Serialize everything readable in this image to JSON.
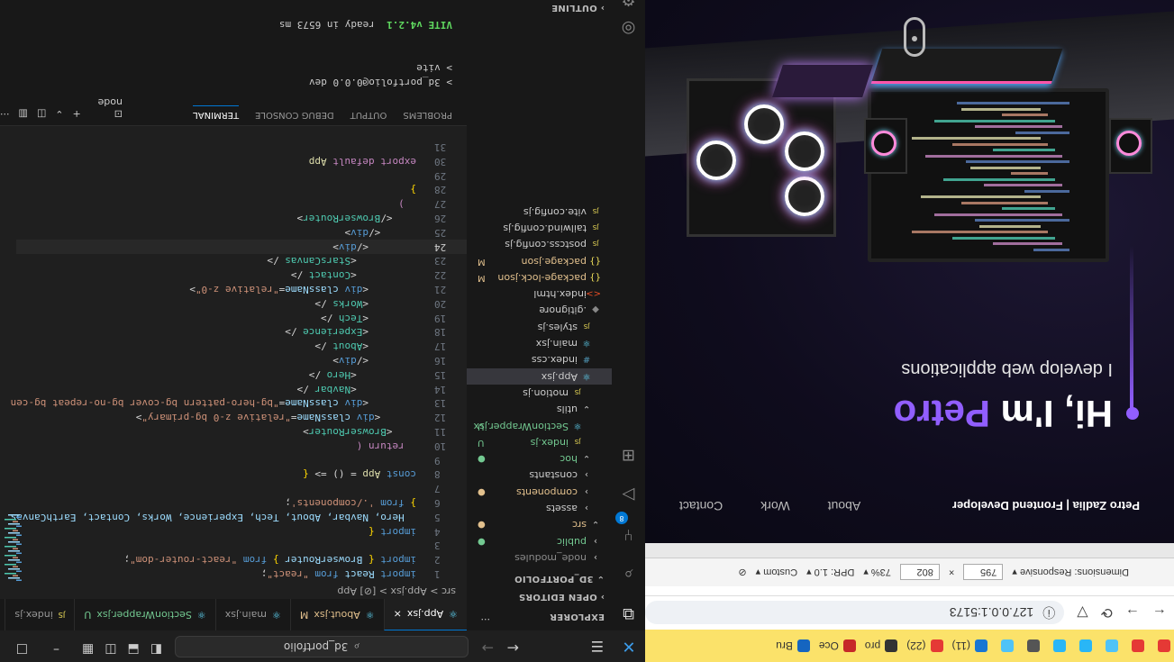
{
  "bookmarks": [
    {
      "label": "",
      "color": "#e53935"
    },
    {
      "label": "",
      "color": "#e53935"
    },
    {
      "label": "",
      "color": "#4fc3f7"
    },
    {
      "label": "",
      "color": "#29b6f6"
    },
    {
      "label": "",
      "color": "#29b6f6"
    },
    {
      "label": "",
      "color": "#555555"
    },
    {
      "label": "",
      "color": "#4fc3f7"
    },
    {
      "label": "(11)",
      "color": "#1976d2"
    },
    {
      "label": "(22)",
      "color": "#e53935"
    },
    {
      "label": "pro",
      "color": "#333333"
    },
    {
      "label": "Oce",
      "color": "#c62828"
    },
    {
      "label": "Bru",
      "color": "#1565c0"
    }
  ],
  "browser": {
    "url": "127.0.0.1:5173",
    "devtools": {
      "dimensions": "Dimensions: Responsive",
      "width": "795",
      "height": "802",
      "zoom": "73%",
      "dpr": "DPR: 1.0",
      "throttle": "Custom"
    }
  },
  "site": {
    "brand": "Petro Zadlia | Frontend Developer",
    "nav": [
      "About",
      "Work",
      "Contact"
    ],
    "hero_prefix": "Hi, I'm ",
    "hero_name": "Petro",
    "hero_sub": "I develop web applications"
  },
  "vscode": {
    "search_text": "3d_portfolio",
    "tabs": [
      {
        "label": "App.jsx",
        "icon": "react-icon",
        "active": true,
        "status": ""
      },
      {
        "label": "About.jsx",
        "icon": "react-icon",
        "active": false,
        "status": "M"
      },
      {
        "label": "main.jsx",
        "icon": "react-icon",
        "active": false,
        "status": ""
      },
      {
        "label": "SectionWrapper.jsx",
        "icon": "react-icon",
        "active": false,
        "status": "U"
      },
      {
        "label": "index.js",
        "icon": "js-icon",
        "active": false,
        "status": ""
      }
    ],
    "breadcrumb": "src > App.jsx > [⊘] App",
    "sidebar": {
      "explorer_title": "EXPLORER",
      "open_editors": "OPEN EDITORS",
      "project": "3D_PORTFOLIO",
      "outline": "OUTLINE",
      "tree": [
        {
          "label": "node_modules",
          "icon": "chevron-right",
          "depth": 0,
          "status": "",
          "color": "#8b8b8b"
        },
        {
          "label": "public",
          "icon": "chevron-right",
          "depth": 0,
          "status": "●",
          "color": "#73c991"
        },
        {
          "label": "src",
          "icon": "chevron-down",
          "depth": 0,
          "status": "●",
          "color": "#e2c08d"
        },
        {
          "label": "assets",
          "icon": "chevron-right",
          "depth": 1,
          "status": "",
          "color": "#cccccc"
        },
        {
          "label": "components",
          "icon": "chevron-right",
          "depth": 1,
          "status": "●",
          "color": "#e2c08d"
        },
        {
          "label": "constants",
          "icon": "chevron-right",
          "depth": 1,
          "status": "",
          "color": "#cccccc"
        },
        {
          "label": "hoc",
          "icon": "chevron-down",
          "depth": 1,
          "status": "●",
          "color": "#73c991"
        },
        {
          "label": "index.js",
          "icon": "JS",
          "depth": 2,
          "status": "U",
          "color": "#73c991"
        },
        {
          "label": "SectionWrapper.jsx",
          "icon": "⚛",
          "depth": 2,
          "status": "U",
          "color": "#73c991"
        },
        {
          "label": "utils",
          "icon": "chevron-down",
          "depth": 1,
          "status": "",
          "color": "#cccccc"
        },
        {
          "label": "motion.js",
          "icon": "JS",
          "depth": 2,
          "status": "",
          "color": "#cccccc"
        },
        {
          "label": "App.jsx",
          "icon": "⚛",
          "depth": 1,
          "status": "",
          "color": "#cccccc",
          "selected": true
        },
        {
          "label": "index.css",
          "icon": "#",
          "depth": 1,
          "status": "",
          "color": "#cccccc"
        },
        {
          "label": "main.jsx",
          "icon": "⚛",
          "depth": 1,
          "status": "",
          "color": "#cccccc"
        },
        {
          "label": "styles.js",
          "icon": "JS",
          "depth": 1,
          "status": "",
          "color": "#cccccc"
        },
        {
          "label": ".gitignore",
          "icon": "◆",
          "depth": 0,
          "status": "",
          "color": "#cccccc"
        },
        {
          "label": "index.html",
          "icon": "<>",
          "depth": 0,
          "status": "",
          "color": "#cccccc"
        },
        {
          "label": "package-lock.json",
          "icon": "{}",
          "depth": 0,
          "status": "M",
          "color": "#e2c08d"
        },
        {
          "label": "package.json",
          "icon": "{}",
          "depth": 0,
          "status": "M",
          "color": "#e2c08d"
        },
        {
          "label": "postcss.config.js",
          "icon": "JS",
          "depth": 0,
          "status": "",
          "color": "#cccccc"
        },
        {
          "label": "tailwind.config.js",
          "icon": "JS",
          "depth": 0,
          "status": "",
          "color": "#cccccc"
        },
        {
          "label": "vite.config.js",
          "icon": "JS",
          "depth": 0,
          "status": "",
          "color": "#cccccc"
        }
      ]
    },
    "code_lines": [
      {
        "n": "1",
        "html": "<span class='kw'>import</span> <span class='at'>React</span> <span class='kw'>from</span> <span class='sr'>\"react\"</span><span class='pl'>;</span>"
      },
      {
        "n": "2",
        "html": "<span class='kw'>import</span> <span class='br'>{</span> <span class='at'>BrowserRouter</span> <span class='br'>}</span> <span class='kw'>from</span> <span class='sr'>\"react-router-dom\"</span><span class='pl'>;</span>"
      },
      {
        "n": "3",
        "html": ""
      },
      {
        "n": "4",
        "html": "<span class='kw'>import</span> <span class='br'>{</span>"
      },
      {
        "n": "5",
        "html": "  <span class='at'>Hero, Navbar, About, Tech, Experience, Works, Contact, EarthCanvas</span>"
      },
      {
        "n": "6",
        "html": "<span class='br'>}</span> <span class='kw'>from</span> <span class='sr'>'./components'</span><span class='pl'>;</span>"
      },
      {
        "n": "7",
        "html": ""
      },
      {
        "n": "8",
        "html": "<span class='kw'>const</span> <span class='fn'>App</span> <span class='pl'>= () =&gt;</span> <span class='br'>{</span>"
      },
      {
        "n": "9",
        "html": ""
      },
      {
        "n": "10",
        "html": "  <span class='kc'>return</span> <span class='kc'>(</span>"
      },
      {
        "n": "11",
        "html": "    <span class='pl'>&lt;</span><span class='tg'>BrowserRouter</span><span class='pl'>&gt;</span>"
      },
      {
        "n": "12",
        "html": "      <span class='pl'>&lt;</span><span class='kw'>div</span> <span class='at'>className</span><span class='pl'>=</span><span class='sr'>\"relative z-0 bg-primary\"</span><span class='pl'>&gt;</span>"
      },
      {
        "n": "13",
        "html": "        <span class='pl'>&lt;</span><span class='kw'>div</span> <span class='at'>className</span><span class='pl'>=</span><span class='sr'>\"bg-hero-pattern bg-cover bg-no-repeat bg-cen</span>"
      },
      {
        "n": "14",
        "html": "          <span class='pl'>&lt;</span><span class='tg'>Navbar</span> <span class='pl'>/&gt;</span>"
      },
      {
        "n": "15",
        "html": "          <span class='pl'>&lt;</span><span class='tg'>Hero</span> <span class='pl'>/&gt;</span>"
      },
      {
        "n": "16",
        "html": "        <span class='pl'>&lt;/</span><span class='kw'>div</span><span class='pl'>&gt;</span>"
      },
      {
        "n": "17",
        "html": "        <span class='pl'>&lt;</span><span class='tg'>About</span> <span class='pl'>/&gt;</span>"
      },
      {
        "n": "18",
        "html": "        <span class='pl'>&lt;</span><span class='tg'>Experience</span> <span class='pl'>/&gt;</span>"
      },
      {
        "n": "19",
        "html": "        <span class='pl'>&lt;</span><span class='tg'>Tech</span> <span class='pl'>/&gt;</span>"
      },
      {
        "n": "20",
        "html": "        <span class='pl'>&lt;</span><span class='tg'>Works</span> <span class='pl'>/&gt;</span>"
      },
      {
        "n": "21",
        "html": "        <span class='pl'>&lt;</span><span class='kw'>div</span> <span class='at'>className</span><span class='pl'>=</span><span class='sr'>\"relative z-0\"</span><span class='pl'>&gt;</span>"
      },
      {
        "n": "22",
        "html": "          <span class='pl'>&lt;</span><span class='tg'>Contact</span> <span class='pl'>/&gt;</span>"
      },
      {
        "n": "23",
        "html": "          <span class='pl'>&lt;</span><span class='tg'>StarsCanvas</span> <span class='pl'>/&gt;</span>"
      },
      {
        "n": "24",
        "html": "        <span class='pl'>&lt;/</span><span class='kw'>div</span><span class='pl'>&gt;</span>"
      },
      {
        "n": "25",
        "html": "      <span class='pl'>&lt;/</span><span class='kw'>div</span><span class='pl'>&gt;</span>"
      },
      {
        "n": "26",
        "html": "    <span class='pl'>&lt;/</span><span class='tg'>BrowserRouter</span><span class='pl'>&gt;</span>"
      },
      {
        "n": "27",
        "html": "  <span class='kc'>)</span>"
      },
      {
        "n": "28",
        "html": "<span class='br'>}</span>"
      },
      {
        "n": "29",
        "html": ""
      },
      {
        "n": "30",
        "html": "<span class='kc'>export</span> <span class='kc'>default</span> <span class='fn'>App</span>"
      },
      {
        "n": "31",
        "html": ""
      }
    ],
    "current_line": "24",
    "panel": {
      "tabs": [
        "PROBLEMS",
        "OUTPUT",
        "DEBUG CONSOLE",
        "TERMINAL"
      ],
      "active_tab": "TERMINAL",
      "shell": "node",
      "term_lines": [
        "> 3d_portfolio@0.0.0 dev",
        "> vite",
        "",
        ""
      ],
      "vite_label": "VITE v4.2.1",
      "ready_text": "  ready in 6573 ms"
    }
  }
}
